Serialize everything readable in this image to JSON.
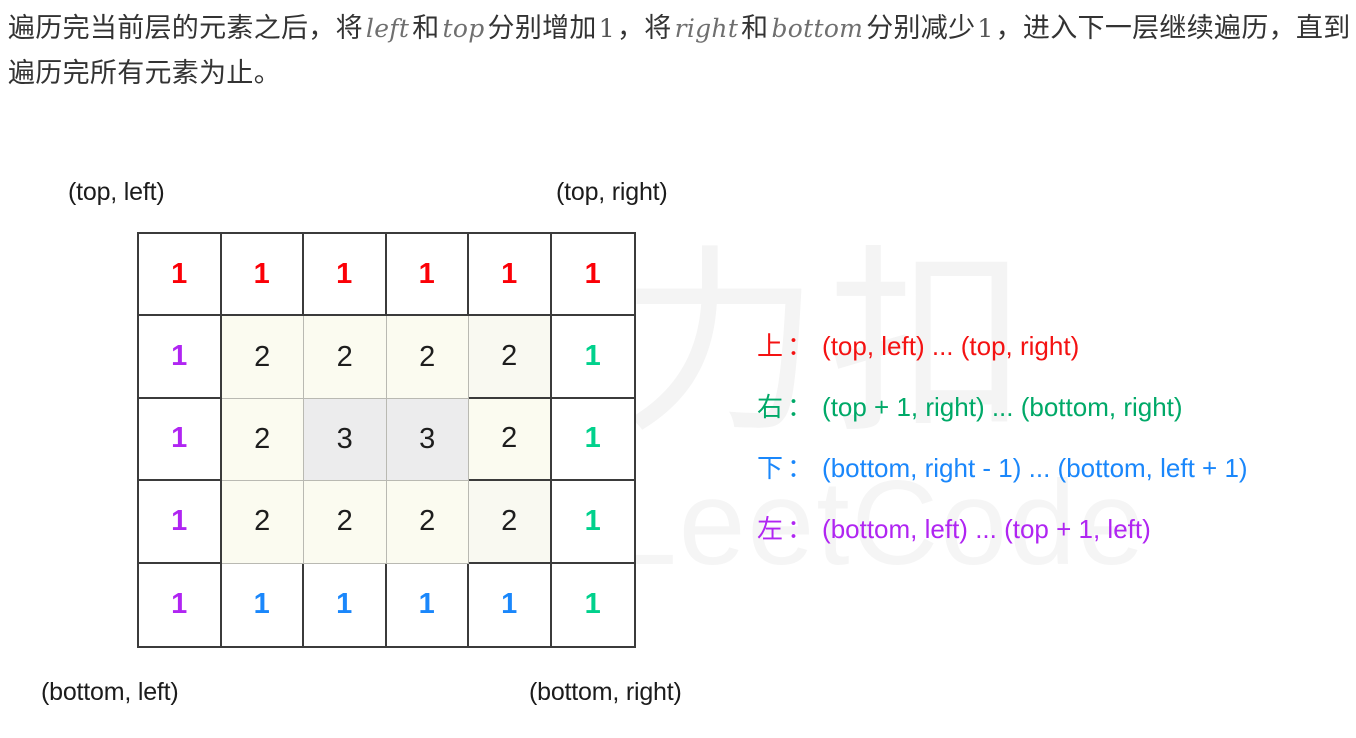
{
  "paragraph": {
    "line1_seg1": "遍历完当前层的元素之后，将",
    "math_left": "left",
    "line1_seg2": "和",
    "math_top": "top",
    "line1_seg3": "分别增加",
    "num_one_a": "1",
    "line1_seg4": "，将",
    "math_right": "right",
    "line1_seg5": "和",
    "math_bottom": "bottom",
    "line1_seg6": "分别减少",
    "num_one_b": "1",
    "line1_seg7": "，进入下一层继续遍历，直到遍历完所有元素为止。"
  },
  "labels": {
    "top_left": "(top, left)",
    "top_right": "(top, right)",
    "bottom_left": "(bottom, left)",
    "bottom_right": "(bottom, right)"
  },
  "watermark": {
    "cn": "力扣",
    "en": "LeetCode"
  },
  "grid": {
    "rows": 5,
    "cols": 6,
    "cells": [
      [
        {
          "value": "1",
          "color": "v-red",
          "shade": "sh-none"
        },
        {
          "value": "1",
          "color": "v-red",
          "shade": "sh-none"
        },
        {
          "value": "1",
          "color": "v-red",
          "shade": "sh-none"
        },
        {
          "value": "1",
          "color": "v-red",
          "shade": "sh-none"
        },
        {
          "value": "1",
          "color": "v-red",
          "shade": "sh-none"
        },
        {
          "value": "1",
          "color": "v-red",
          "shade": "sh-none"
        }
      ],
      [
        {
          "value": "1",
          "color": "v-purple",
          "shade": "sh-none"
        },
        {
          "value": "2",
          "color": "v-black",
          "shade": "sh-cream"
        },
        {
          "value": "2",
          "color": "v-black",
          "shade": "sh-cream"
        },
        {
          "value": "2",
          "color": "v-black",
          "shade": "sh-cream"
        },
        {
          "value": "2",
          "color": "v-black",
          "shade": "sh-cream-soft"
        },
        {
          "value": "1",
          "color": "v-green",
          "shade": "sh-none"
        }
      ],
      [
        {
          "value": "1",
          "color": "v-purple",
          "shade": "sh-none"
        },
        {
          "value": "2",
          "color": "v-black",
          "shade": "sh-cream"
        },
        {
          "value": "3",
          "color": "v-black",
          "shade": "sh-gray"
        },
        {
          "value": "3",
          "color": "v-black",
          "shade": "sh-gray"
        },
        {
          "value": "2",
          "color": "v-black",
          "shade": "sh-cream"
        },
        {
          "value": "1",
          "color": "v-green",
          "shade": "sh-none"
        }
      ],
      [
        {
          "value": "1",
          "color": "v-purple",
          "shade": "sh-none"
        },
        {
          "value": "2",
          "color": "v-black",
          "shade": "sh-cream"
        },
        {
          "value": "2",
          "color": "v-black",
          "shade": "sh-cream"
        },
        {
          "value": "2",
          "color": "v-black",
          "shade": "sh-cream"
        },
        {
          "value": "2",
          "color": "v-black",
          "shade": "sh-cream-soft"
        },
        {
          "value": "1",
          "color": "v-green",
          "shade": "sh-none"
        }
      ],
      [
        {
          "value": "1",
          "color": "v-purple",
          "shade": "sh-none"
        },
        {
          "value": "1",
          "color": "v-blue",
          "shade": "sh-none"
        },
        {
          "value": "1",
          "color": "v-blue",
          "shade": "sh-none"
        },
        {
          "value": "1",
          "color": "v-blue",
          "shade": "sh-none"
        },
        {
          "value": "1",
          "color": "v-blue",
          "shade": "sh-none"
        },
        {
          "value": "1",
          "color": "v-green",
          "shade": "sh-none"
        }
      ]
    ]
  },
  "legend": {
    "items": [
      {
        "key": "上",
        "colon": "：",
        "text": "(top, left) ... (top, right)",
        "color_class": "lg-red",
        "color_hex": "#F41212"
      },
      {
        "key": "右",
        "colon": "：",
        "text": "(top + 1, right) ... (bottom, right)",
        "color_class": "lg-green",
        "color_hex": "#00A968"
      },
      {
        "key": "下",
        "colon": "：",
        "text": "(bottom, right - 1) ... (bottom, left + 1)",
        "color_class": "lg-blue",
        "color_hex": "#1A87FB"
      },
      {
        "key": "左",
        "colon": "：",
        "text": "(bottom, left) ... (top + 1, left)",
        "color_class": "lg-purple",
        "color_hex": "#B025F2"
      }
    ]
  },
  "colors": {
    "red": "#FB0007",
    "purple": "#B025F2",
    "green": "#00D18C",
    "blue": "#1A87FB",
    "grid_border": "#3B3B3B",
    "cell_cream": "#FBFBF0",
    "cell_gray": "#ECECED",
    "watermark": "#F4F4F4"
  }
}
